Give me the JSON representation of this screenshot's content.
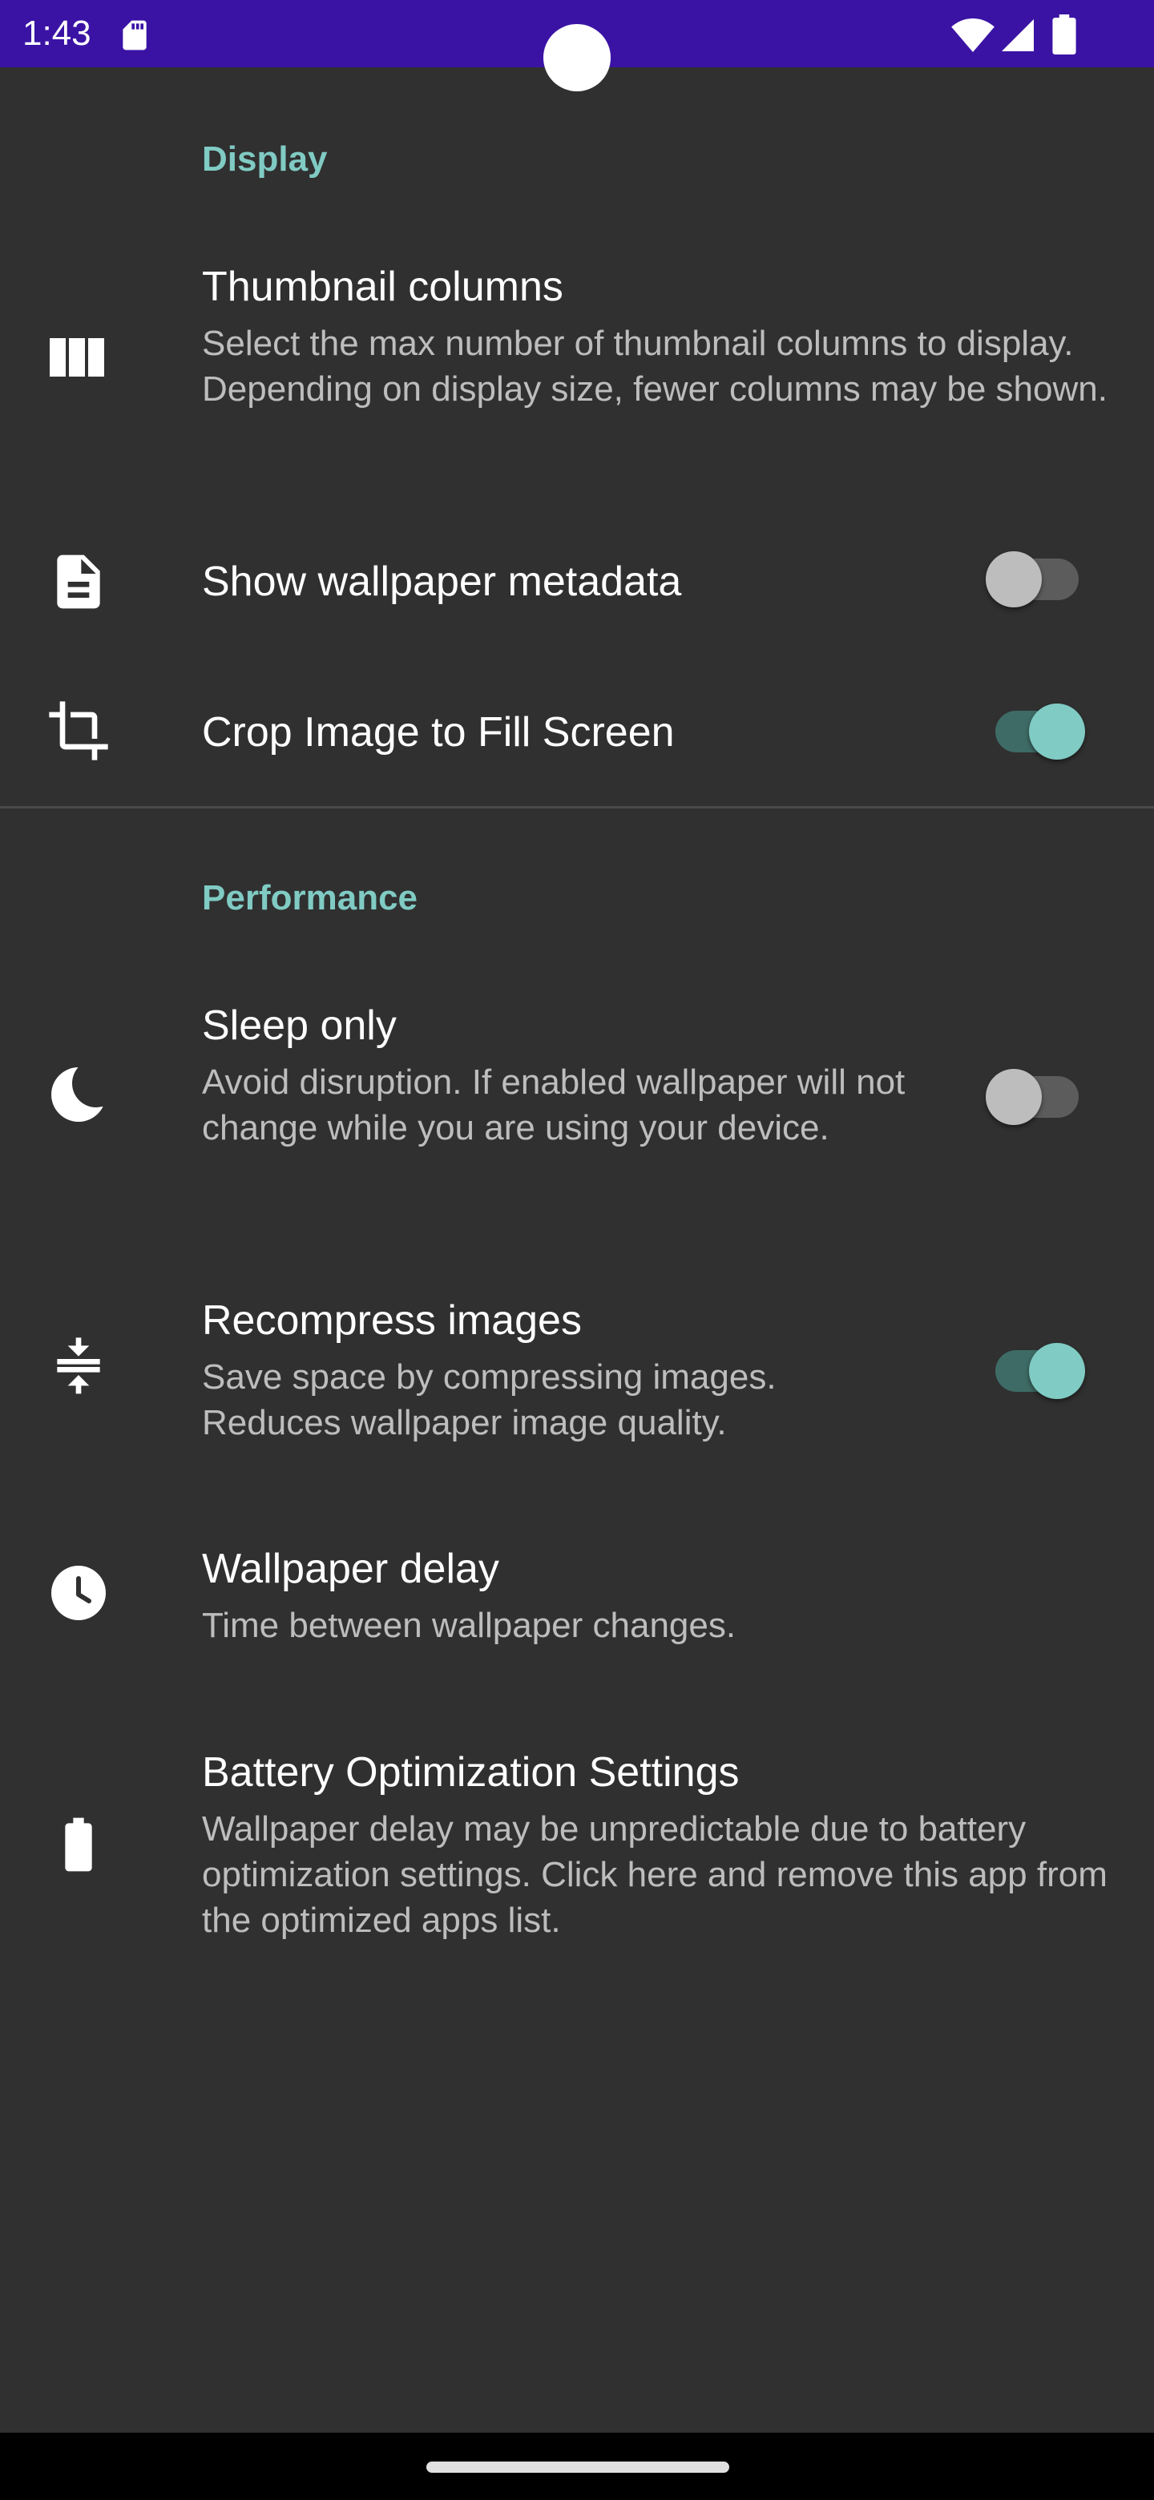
{
  "status_bar": {
    "time": "1:43",
    "icons": [
      "sd-card-icon",
      "wifi-icon",
      "signal-icon",
      "battery-icon"
    ]
  },
  "sections": {
    "display": {
      "header": "Display"
    },
    "performance": {
      "header": "Performance"
    }
  },
  "prefs": {
    "thumbnail_columns": {
      "title": "Thumbnail columns",
      "summary": "Select the max number of thumbnail columns to display. Depending on display size, fewer columns may be shown.",
      "icon": "view-column-icon"
    },
    "show_metadata": {
      "title": "Show wallpaper metadata",
      "icon": "description-icon",
      "switch_on": false
    },
    "crop_image": {
      "title": "Crop Image to Fill Screen",
      "icon": "crop-icon",
      "switch_on": true
    },
    "sleep_only": {
      "title": "Sleep only",
      "summary": "Avoid disruption. If enabled wallpaper will not change while you are using your device.",
      "icon": "moon-icon",
      "switch_on": false
    },
    "recompress": {
      "title": "Recompress images",
      "summary": "Save space by compressing images. Reduces wallpaper image quality.",
      "icon": "compress-icon",
      "switch_on": true
    },
    "wallpaper_delay": {
      "title": "Wallpaper delay",
      "summary": "Time between wallpaper changes.",
      "icon": "clock-icon"
    },
    "battery_optimization": {
      "title": "Battery Optimization Settings",
      "summary": "Wallpaper delay may be unpredictable due to battery optimization settings. Click here and remove this app from the optimized apps list.",
      "icon": "battery-icon"
    }
  },
  "colors": {
    "accent": "#80cbc4",
    "background": "#303030",
    "status_bar": "#3a13a5",
    "summary_text": "#bdbdbd"
  }
}
